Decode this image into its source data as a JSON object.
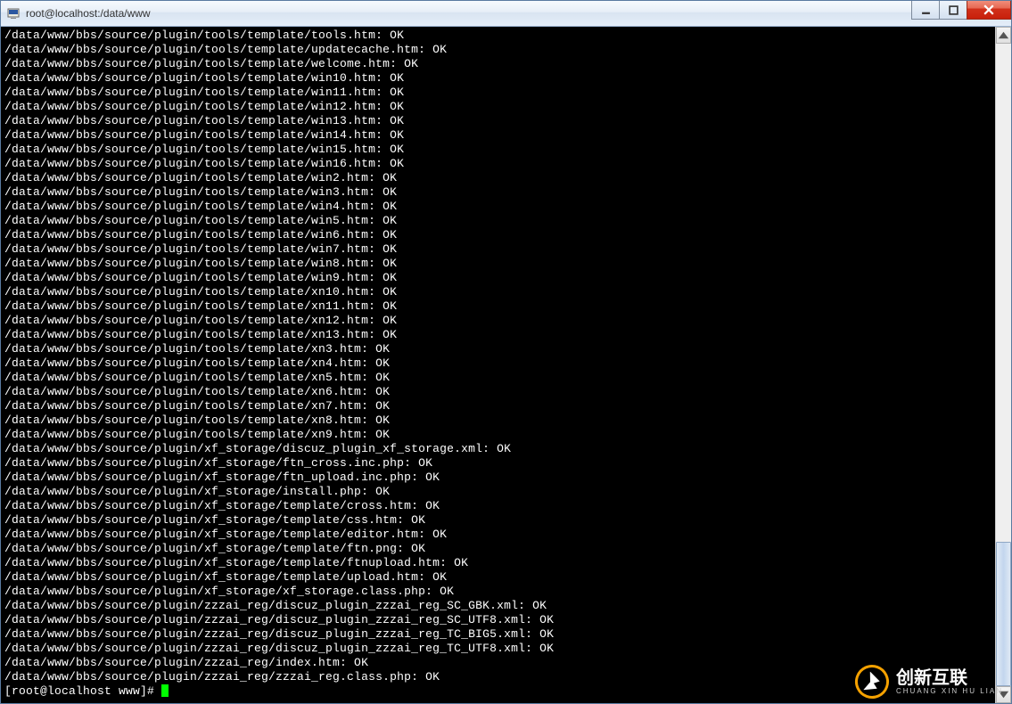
{
  "window": {
    "title": "root@localhost:/data/www"
  },
  "terminal": {
    "lines": [
      "/data/www/bbs/source/plugin/tools/template/tools.htm: OK",
      "/data/www/bbs/source/plugin/tools/template/updatecache.htm: OK",
      "/data/www/bbs/source/plugin/tools/template/welcome.htm: OK",
      "/data/www/bbs/source/plugin/tools/template/win10.htm: OK",
      "/data/www/bbs/source/plugin/tools/template/win11.htm: OK",
      "/data/www/bbs/source/plugin/tools/template/win12.htm: OK",
      "/data/www/bbs/source/plugin/tools/template/win13.htm: OK",
      "/data/www/bbs/source/plugin/tools/template/win14.htm: OK",
      "/data/www/bbs/source/plugin/tools/template/win15.htm: OK",
      "/data/www/bbs/source/plugin/tools/template/win16.htm: OK",
      "/data/www/bbs/source/plugin/tools/template/win2.htm: OK",
      "/data/www/bbs/source/plugin/tools/template/win3.htm: OK",
      "/data/www/bbs/source/plugin/tools/template/win4.htm: OK",
      "/data/www/bbs/source/plugin/tools/template/win5.htm: OK",
      "/data/www/bbs/source/plugin/tools/template/win6.htm: OK",
      "/data/www/bbs/source/plugin/tools/template/win7.htm: OK",
      "/data/www/bbs/source/plugin/tools/template/win8.htm: OK",
      "/data/www/bbs/source/plugin/tools/template/win9.htm: OK",
      "/data/www/bbs/source/plugin/tools/template/xn10.htm: OK",
      "/data/www/bbs/source/plugin/tools/template/xn11.htm: OK",
      "/data/www/bbs/source/plugin/tools/template/xn12.htm: OK",
      "/data/www/bbs/source/plugin/tools/template/xn13.htm: OK",
      "/data/www/bbs/source/plugin/tools/template/xn3.htm: OK",
      "/data/www/bbs/source/plugin/tools/template/xn4.htm: OK",
      "/data/www/bbs/source/plugin/tools/template/xn5.htm: OK",
      "/data/www/bbs/source/plugin/tools/template/xn6.htm: OK",
      "/data/www/bbs/source/plugin/tools/template/xn7.htm: OK",
      "/data/www/bbs/source/plugin/tools/template/xn8.htm: OK",
      "/data/www/bbs/source/plugin/tools/template/xn9.htm: OK",
      "/data/www/bbs/source/plugin/xf_storage/discuz_plugin_xf_storage.xml: OK",
      "/data/www/bbs/source/plugin/xf_storage/ftn_cross.inc.php: OK",
      "/data/www/bbs/source/plugin/xf_storage/ftn_upload.inc.php: OK",
      "/data/www/bbs/source/plugin/xf_storage/install.php: OK",
      "/data/www/bbs/source/plugin/xf_storage/template/cross.htm: OK",
      "/data/www/bbs/source/plugin/xf_storage/template/css.htm: OK",
      "/data/www/bbs/source/plugin/xf_storage/template/editor.htm: OK",
      "/data/www/bbs/source/plugin/xf_storage/template/ftn.png: OK",
      "/data/www/bbs/source/plugin/xf_storage/template/ftnupload.htm: OK",
      "/data/www/bbs/source/plugin/xf_storage/template/upload.htm: OK",
      "/data/www/bbs/source/plugin/xf_storage/xf_storage.class.php: OK",
      "/data/www/bbs/source/plugin/zzzai_reg/discuz_plugin_zzzai_reg_SC_GBK.xml: OK",
      "/data/www/bbs/source/plugin/zzzai_reg/discuz_plugin_zzzai_reg_SC_UTF8.xml: OK",
      "/data/www/bbs/source/plugin/zzzai_reg/discuz_plugin_zzzai_reg_TC_BIG5.xml: OK",
      "/data/www/bbs/source/plugin/zzzai_reg/discuz_plugin_zzzai_reg_TC_UTF8.xml: OK",
      "/data/www/bbs/source/plugin/zzzai_reg/index.htm: OK",
      "/data/www/bbs/source/plugin/zzzai_reg/zzzai_reg.class.php: OK"
    ],
    "prompt": "[root@localhost www]# "
  },
  "watermark": {
    "main": "创新互联",
    "sub": "CHUANG XIN HU LIAN"
  }
}
